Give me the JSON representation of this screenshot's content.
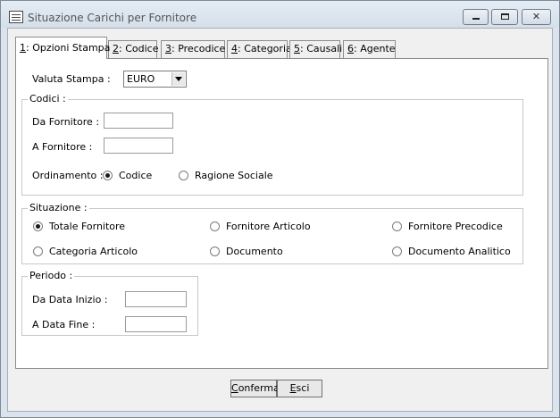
{
  "window": {
    "title": "Situazione Carichi per Fornitore"
  },
  "tabs": [
    {
      "key": "1",
      "rest": ": Opzioni Stampa"
    },
    {
      "key": "2",
      "rest": ": Codice"
    },
    {
      "key": "3",
      "rest": ": Precodice"
    },
    {
      "key": "4",
      "rest": ": Categoria"
    },
    {
      "key": "5",
      "rest": ": Causali"
    },
    {
      "key": "6",
      "rest": ": Agente"
    }
  ],
  "valuta": {
    "label": "Valuta Stampa :",
    "value": "EURO"
  },
  "codici": {
    "title": "Codici :",
    "da_label": "Da Fornitore :",
    "da_value": "",
    "a_label": "A Fornitore :",
    "a_value": "",
    "ord_label": "Ordinamento :",
    "ord_opt1": "Codice",
    "ord_opt2": "Ragione Sociale",
    "ord_selected": "Codice"
  },
  "situazione": {
    "title": "Situazione :",
    "options": [
      "Totale Fornitore",
      "Fornitore Articolo",
      "Fornitore Precodice",
      "Categoria Articolo",
      "Documento",
      "Documento Analitico"
    ],
    "selected": "Totale Fornitore"
  },
  "periodo": {
    "title": "Periodo :",
    "inizio_label": "Da Data Inizio :",
    "inizio_value": "",
    "fine_label": "A Data Fine :",
    "fine_value": ""
  },
  "buttons": {
    "conferma_mnemonic": "C",
    "conferma_rest": "onferma",
    "esci_mnemonic": "E",
    "esci_rest": "sci"
  }
}
